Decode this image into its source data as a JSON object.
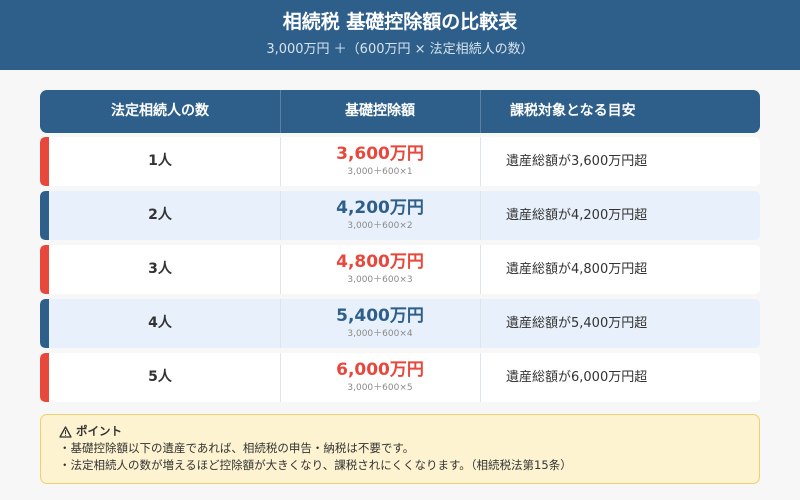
{
  "header": {
    "title": "相続税 基礎控除額の比較表",
    "subtitle": "3,000万円 ＋（600万円 × 法定相続人の数）"
  },
  "table": {
    "columns": [
      "法定相続人の数",
      "基礎控除額",
      "課税対象となる目安"
    ],
    "rows": [
      {
        "heirs": "1人",
        "amount": "3,600万円",
        "calc": "3,000＋600×1",
        "target": "遺産総額が3,600万円超",
        "accent": "#e8483c"
      },
      {
        "heirs": "2人",
        "amount": "4,200万円",
        "calc": "3,000＋600×2",
        "target": "遺産総額が4,200万円超",
        "accent": "#2e5f8a"
      },
      {
        "heirs": "3人",
        "amount": "4,800万円",
        "calc": "3,000＋600×3",
        "target": "遺産総額が4,800万円超",
        "accent": "#e8483c"
      },
      {
        "heirs": "4人",
        "amount": "5,400万円",
        "calc": "3,000＋600×4",
        "target": "遺産総額が5,400万円超",
        "accent": "#2e5f8a"
      },
      {
        "heirs": "5人",
        "amount": "6,000万円",
        "calc": "3,000＋600×5",
        "target": "遺産総額が6,000万円超",
        "accent": "#e8483c"
      }
    ]
  },
  "notice": {
    "icon": "warning-icon",
    "title": "ポイント",
    "lines": [
      "・基礎控除額以下の遺産であれば、相続税の申告・納税は不要です。",
      "・法定相続人の数が増えるほど控除額が大きくなり、課税されにくくなります。（相続税法第15条）"
    ]
  },
  "colors": {
    "header_bg": "#2e5f8a",
    "accent_red": "#e8483c",
    "accent_blue": "#2e5f8a",
    "notice_bg": "#fdf3d0",
    "notice_border": "#f1cf6e"
  }
}
